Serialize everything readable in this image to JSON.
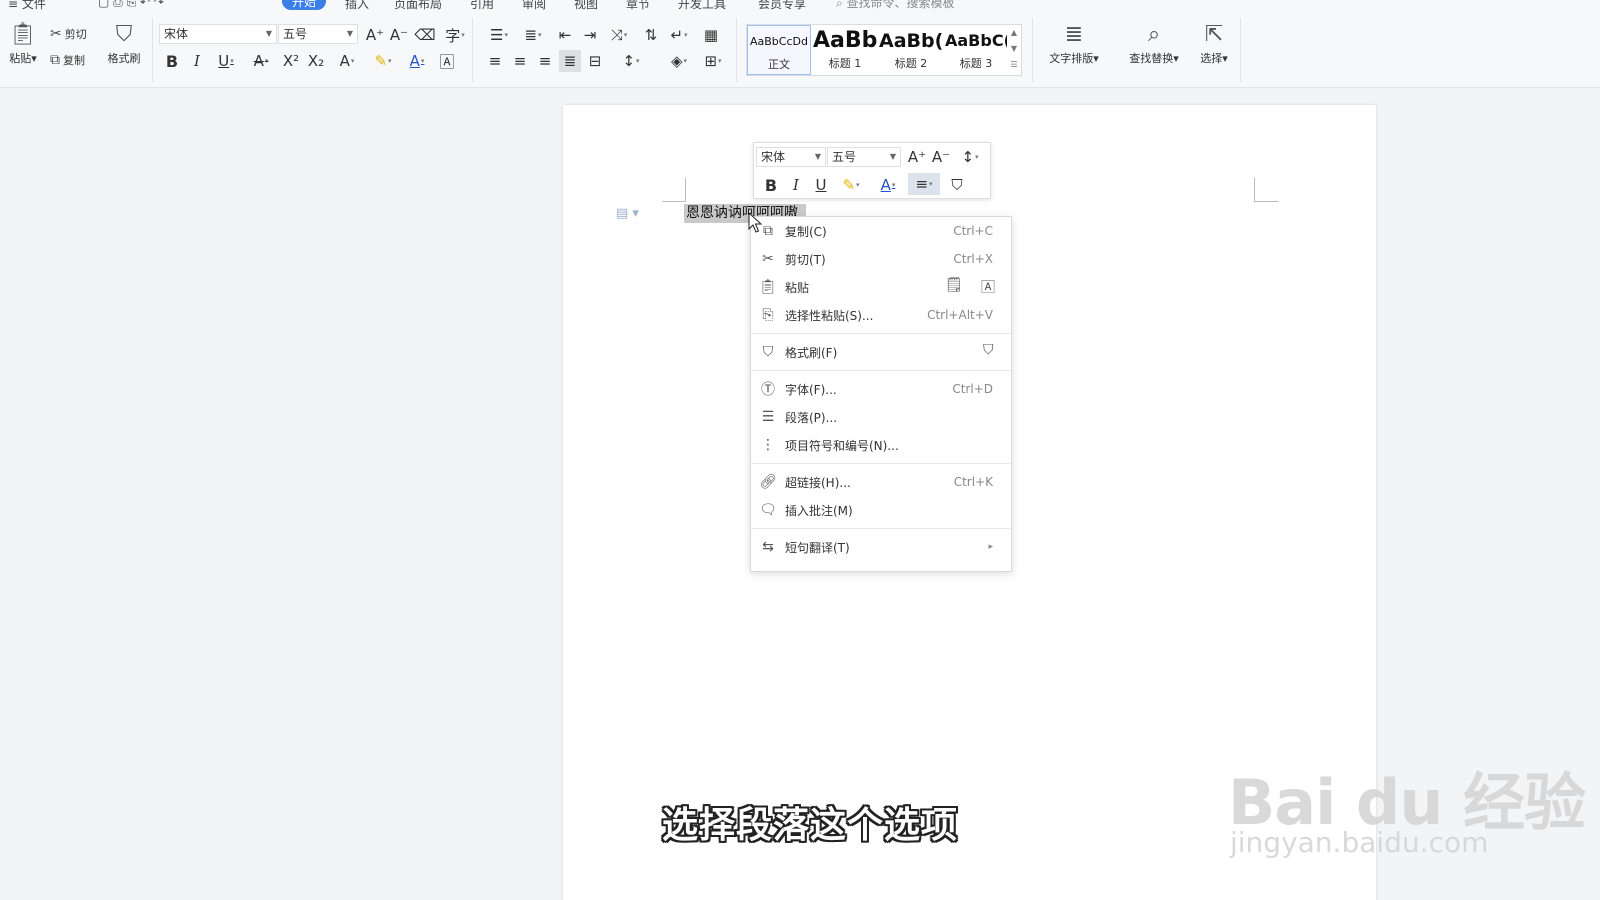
{
  "menubar": {
    "items": [
      "文件",
      "开始",
      "插入",
      "页面布局",
      "引用",
      "审阅",
      "视图",
      "章节",
      "开发工具",
      "会员专享"
    ],
    "active": "开始",
    "search_placeholder": "查找命令、搜索模板"
  },
  "ribbon": {
    "paste": "粘贴",
    "cut": "剪切",
    "copy": "复制",
    "format_painter": "格式刷",
    "font_name": "宋体",
    "font_size": "五号",
    "styles": [
      {
        "preview": "AaBbCcDd",
        "name": "正文"
      },
      {
        "preview": "AaBb",
        "name": "标题 1"
      },
      {
        "preview": "AaBb(",
        "name": "标题 2"
      },
      {
        "preview": "AaBbC(",
        "name": "标题 3"
      }
    ],
    "text_layout": "文字排版",
    "find_replace": "查找替换",
    "select": "选择"
  },
  "document": {
    "selected_text": "恩恩讷讷呵呵呵嗷"
  },
  "mini_toolbar": {
    "font_name": "宋体",
    "font_size": "五号"
  },
  "context_menu": {
    "items": [
      {
        "icon": "copy-icon",
        "label": "复制(C)",
        "shortcut": "Ctrl+C"
      },
      {
        "icon": "scissors-icon",
        "label": "剪切(T)",
        "shortcut": "Ctrl+X"
      },
      {
        "icon": "paste-icon",
        "label": "粘贴",
        "shortcut": ""
      },
      {
        "icon": "paste-special-icon",
        "label": "选择性粘贴(S)...",
        "shortcut": "Ctrl+Alt+V"
      },
      {
        "icon": "format-painter-icon",
        "label": "格式刷(F)",
        "shortcut": ""
      },
      {
        "icon": "font-icon",
        "label": "字体(F)...",
        "shortcut": "Ctrl+D"
      },
      {
        "icon": "paragraph-icon",
        "label": "段落(P)...",
        "shortcut": ""
      },
      {
        "icon": "bullets-icon",
        "label": "项目符号和编号(N)...",
        "shortcut": ""
      },
      {
        "icon": "link-icon",
        "label": "超链接(H)...",
        "shortcut": "Ctrl+K"
      },
      {
        "icon": "comment-icon",
        "label": "插入批注(M)",
        "shortcut": ""
      },
      {
        "icon": "translate-icon",
        "label": "短句翻译(T)",
        "shortcut": ""
      }
    ]
  },
  "caption": "选择段落这个选项",
  "watermark": {
    "logo": "Bai du 经验",
    "url": "jingyan.baidu.com"
  },
  "colors": {
    "accent": "#3c7ee7",
    "selection": "#c9c9c9"
  }
}
